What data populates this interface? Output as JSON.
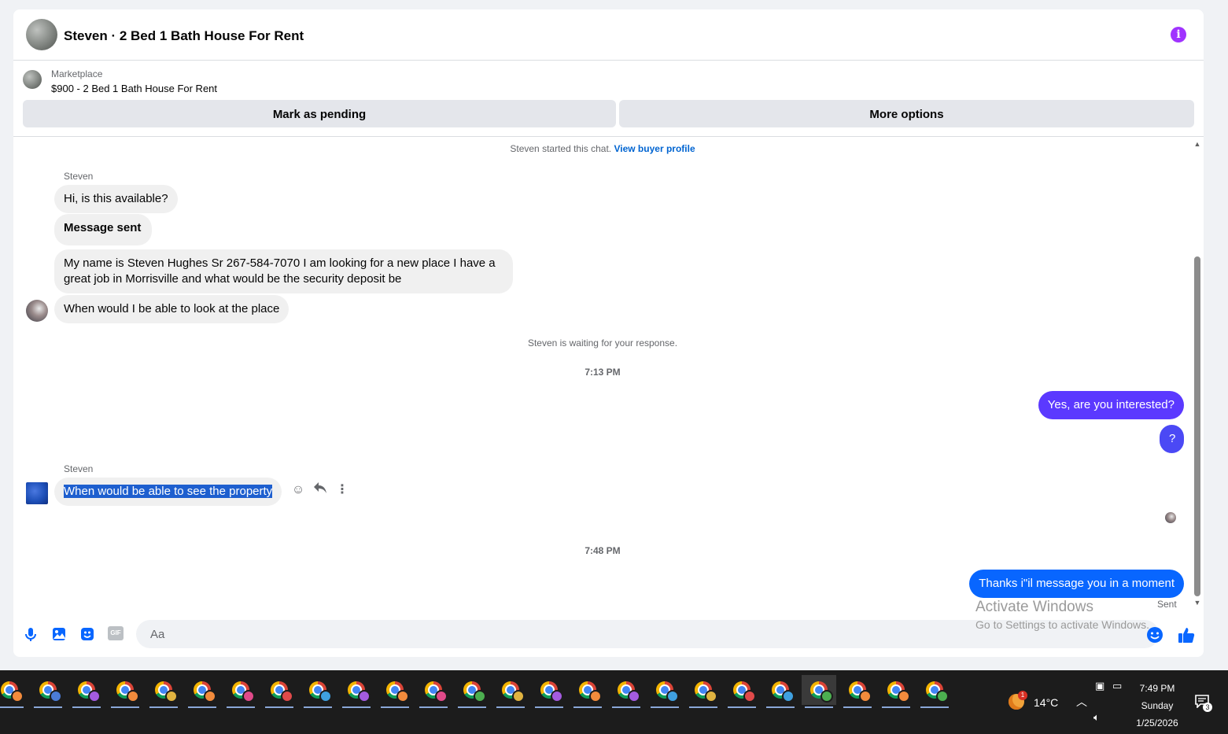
{
  "header": {
    "title": "Steven · 2 Bed 1 Bath House For Rent",
    "info_icon": "i"
  },
  "listing": {
    "label": "Marketplace",
    "title": "$900 - 2 Bed 1 Bath House For Rent"
  },
  "actions": {
    "mark_pending": "Mark as pending",
    "more_options": "More options"
  },
  "conversation": {
    "started_text": "Steven started this chat.",
    "view_profile": "View buyer profile",
    "group1": {
      "sender": "Steven",
      "messages": [
        "Hi, is this available?",
        "Message sent",
        "My name is Steven Hughes Sr 267-584-7070 I am looking for a new place I have a",
        "great job in Morrisville and what would be the security deposit be",
        "When would I be able to look at the place"
      ]
    },
    "waiting_text": "Steven is waiting for your response.",
    "time1": "7:13 PM",
    "outgoing1": [
      "Yes, are you interested?",
      "?"
    ],
    "group2": {
      "sender": "Steven",
      "message": "When would be able to see the property"
    },
    "time2": "7:48 PM",
    "outgoing2": "Thanks i\"il message you in a moment",
    "status": "Sent"
  },
  "composer": {
    "placeholder": "Aa",
    "gif_label": "GIF"
  },
  "watermark": {
    "line1": "Activate Windows",
    "line2": "Go to Settings to activate Windows."
  },
  "taskbar": {
    "weather_temp": "14°C",
    "weather_badge": "1",
    "time": "7:49 PM",
    "day": "Sunday",
    "date": "1/25/2026",
    "notification_count": "3",
    "app_profile_colors": [
      "#f28b3c",
      "#4b7bd6",
      "#a45be0",
      "#f28b3c",
      "#e0b340",
      "#f28b3c",
      "#e04a8a",
      "#e04a4a",
      "#3fa0e0",
      "#a45be0",
      "#f28b3c",
      "#e04a8a",
      "#4caf50",
      "#e0b340",
      "#a45be0",
      "#f28b3c",
      "#a45be0",
      "#3fa0e0",
      "#e0b340",
      "#e04a4a",
      "#3fa0e0",
      "#4caf50",
      "#f28b3c",
      "#f28b3c",
      "#4caf50"
    ]
  },
  "colors": {
    "accent_blue": "#0866ff",
    "purple_bubble": "#5b39ff",
    "info_purple": "#a033ff",
    "incoming_bubble": "#f0f0f0"
  }
}
